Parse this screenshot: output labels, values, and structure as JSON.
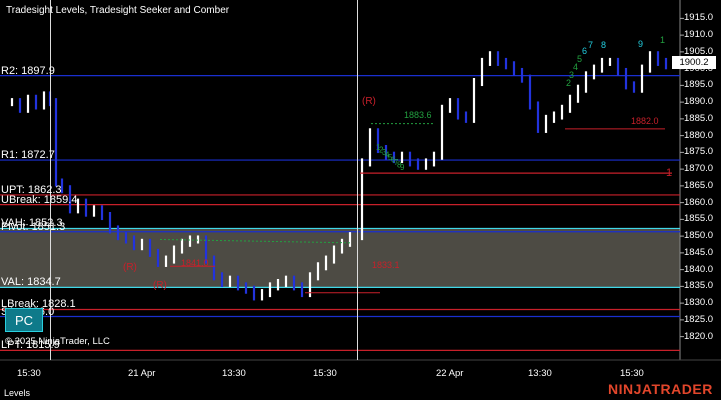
{
  "title": "Tradesight Levels, Tradesight Seeker and Comber",
  "copyright": "© 2025 NinjaTrader, LLC",
  "pc_button": "PC",
  "bottom_tab": "Levels",
  "brand": "NINJATRADER",
  "current_price": "1900.2",
  "colors": {
    "background": "#000000",
    "up_bar": "#ffffff",
    "down_bar": "#2233dd",
    "level_blue": "#1a2fcf",
    "level_red": "#c8202a",
    "value_area": "#5a5850",
    "value_area_edge": "#40d8e8",
    "seeker": "#22a040",
    "seeker_cyan": "#22ccdd",
    "brand": "#e2462b"
  },
  "y_axis": {
    "ticks": [
      "1915.0",
      "1910.0",
      "1905.0",
      "1900.0",
      "1895.0",
      "1890.0",
      "1885.0",
      "1880.0",
      "1875.0",
      "1870.0",
      "1865.0",
      "1860.0",
      "1855.0",
      "1850.0",
      "1845.0",
      "1840.0",
      "1835.0",
      "1830.0",
      "1825.0",
      "1820.0"
    ],
    "min": 1817.5,
    "max": 1917.5
  },
  "x_axis": {
    "labels": [
      "15:30",
      "21 Apr",
      "13:30",
      "15:30",
      "22 Apr",
      "13:30",
      "15:30"
    ]
  },
  "levels": [
    {
      "label": "R2: 1897.9",
      "price": 1897.9,
      "color": "blue"
    },
    {
      "label": "R1: 1872.7",
      "price": 1872.7,
      "color": "blue"
    },
    {
      "label": "UPT: 1862.3",
      "price": 1862.3,
      "color": "red"
    },
    {
      "label": "UBreak: 1859.4",
      "price": 1859.4,
      "color": "red"
    },
    {
      "label": "VAH: 1852.3",
      "price": 1852.3,
      "color": "cyan"
    },
    {
      "label": "Pivot: 1851.3",
      "price": 1851.3,
      "color": "blue"
    },
    {
      "label": "VAL: 1834.7",
      "price": 1834.7,
      "color": "cyan"
    },
    {
      "label": "LBreak: 1828.1",
      "price": 1828.1,
      "color": "red"
    },
    {
      "label": "S1: 1826.0",
      "price": 1826.0,
      "color": "blue"
    },
    {
      "label": "LPT: 1815.9",
      "price": 1815.9,
      "color": "red"
    }
  ],
  "annotations": {
    "r_markers": [
      "(R)",
      "(R)",
      "(R)"
    ],
    "red_values": [
      "1841.0",
      "1833.1",
      "1882.0"
    ],
    "green_values": [
      "1883.6"
    ],
    "red_one": "1",
    "seeker_nums": [
      "9",
      "8",
      "7",
      "6",
      "5",
      "4",
      "3",
      "2",
      "1"
    ]
  }
}
